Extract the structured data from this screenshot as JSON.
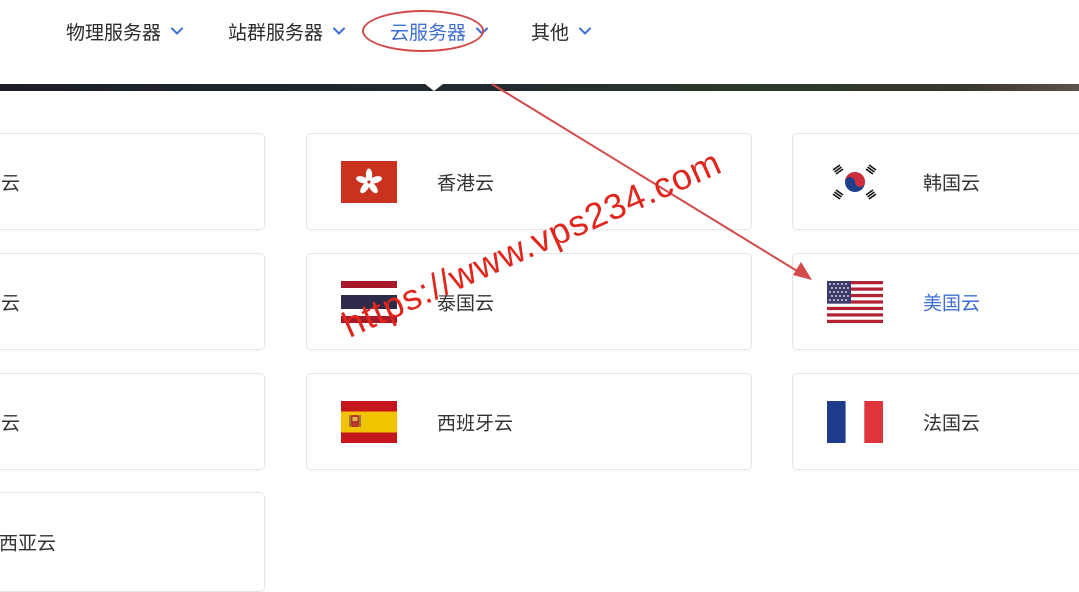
{
  "nav": {
    "items": [
      {
        "label": "物理服务器"
      },
      {
        "label": "站群服务器"
      },
      {
        "label": "云服务器"
      },
      {
        "label": "其他"
      }
    ],
    "active_index": 2
  },
  "cards": {
    "left": [
      {
        "label": "云"
      },
      {
        "label": "云"
      },
      {
        "label": "云"
      },
      {
        "label": "尼西亚云"
      }
    ],
    "middle": [
      {
        "label": "香港云",
        "flag": "hong-kong-flag"
      },
      {
        "label": "泰国云",
        "flag": "thailand-flag"
      },
      {
        "label": "西班牙云",
        "flag": "spain-flag"
      }
    ],
    "right": [
      {
        "label": "韩国云",
        "flag": "south-korea-flag"
      },
      {
        "label": "美国云",
        "flag": "usa-flag"
      },
      {
        "label": "法国云",
        "flag": "france-flag"
      }
    ],
    "active_label": "美国云"
  },
  "annotation": {
    "watermark": "https://www.vps234.com",
    "color": "#e0261c"
  },
  "colors": {
    "accent": "#3f6fd1",
    "annotation_red": "#d24a4a"
  }
}
